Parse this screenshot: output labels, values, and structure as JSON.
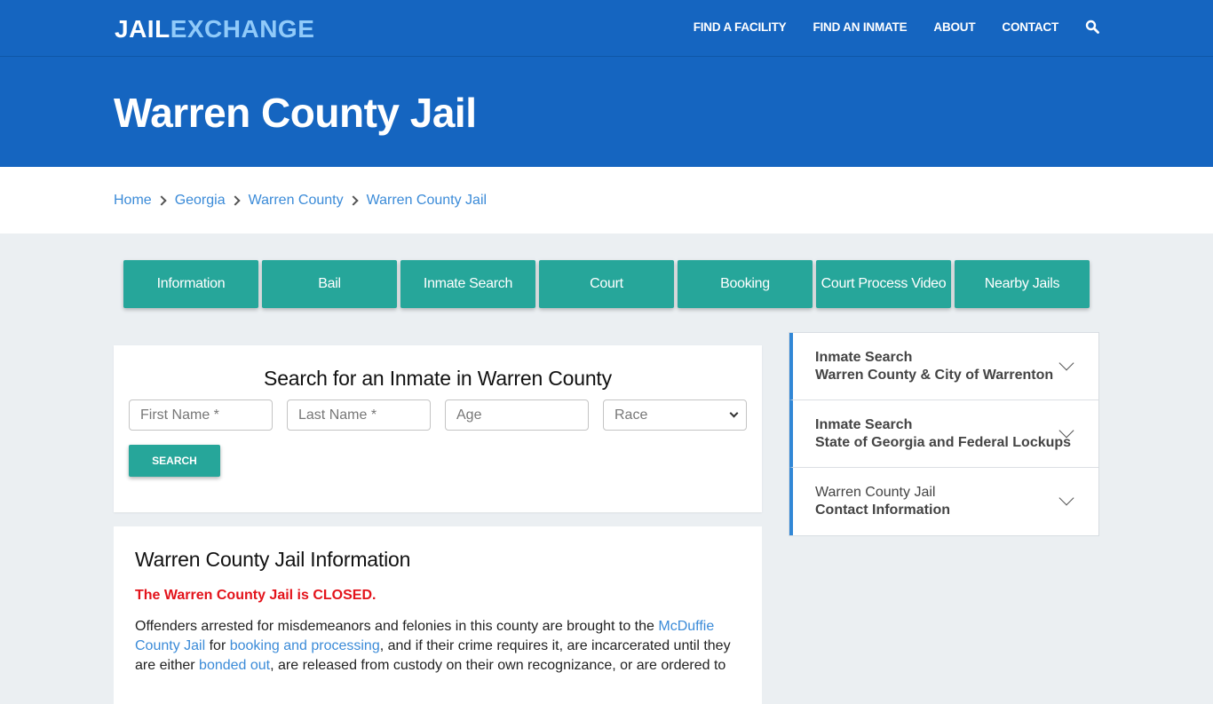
{
  "header": {
    "logo_part1": "JAIL",
    "logo_part2": "EXCHANGE",
    "nav": [
      "FIND A FACILITY",
      "FIND AN INMATE",
      "ABOUT",
      "CONTACT"
    ],
    "search_icon": "search-icon"
  },
  "hero": {
    "title": "Warren County Jail"
  },
  "breadcrumb": [
    "Home",
    "Georgia",
    "Warren County",
    "Warren County Jail"
  ],
  "tabs": [
    "Information",
    "Bail",
    "Inmate Search",
    "Court",
    "Booking",
    "Court Process Video",
    "Nearby Jails"
  ],
  "search": {
    "title": "Search for an Inmate in Warren County",
    "first_name_placeholder": "First Name *",
    "last_name_placeholder": "Last Name *",
    "age_placeholder": "Age",
    "race_selected": "Race",
    "button": "SEARCH"
  },
  "info": {
    "heading": "Warren County Jail Information",
    "closed_notice": "The Warren County Jail is CLOSED.",
    "p1_a": "Offenders arrested for misdemeanors and felonies in this county are brought to the ",
    "p1_link1": "McDuffie County Jail",
    "p1_b": " for ",
    "p1_link2": "booking and processing",
    "p1_c": ", and if their crime requires it, are incarcerated until they are either ",
    "p1_link3": "bonded out",
    "p1_d": ", are released from custody on their own recognizance, or are ordered to"
  },
  "sidebar": [
    {
      "line1": "Inmate Search",
      "line2": "Warren County & City of Warrenton"
    },
    {
      "line1": "Inmate Search",
      "line2": "State of Georgia and Federal Lockups"
    },
    {
      "line1": "Warren County Jail",
      "line2": "Contact Information"
    }
  ],
  "colors": {
    "brand_blue": "#1565c0",
    "accent_teal": "#26a69a",
    "link_blue": "#3b8bd8",
    "alert_red": "#e3131b"
  }
}
